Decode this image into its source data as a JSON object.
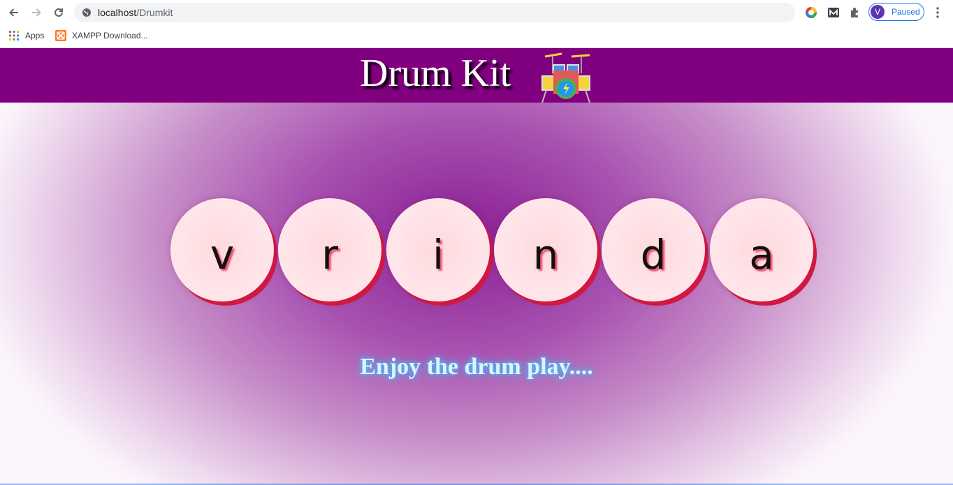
{
  "browser": {
    "url_host": "localhost",
    "url_path": "/Drumkit",
    "profile": {
      "initial": "V",
      "status": "Paused"
    },
    "bookmarks": [
      {
        "label": "Apps",
        "icon": "apps-grid-icon"
      },
      {
        "label": "XAMPP Download...",
        "icon": "xampp-icon"
      }
    ]
  },
  "page": {
    "title": "Drum Kit",
    "logo_icon": "drum-set-icon",
    "drums": [
      {
        "key": "v"
      },
      {
        "key": "r"
      },
      {
        "key": "i"
      },
      {
        "key": "n"
      },
      {
        "key": "d"
      },
      {
        "key": "a"
      }
    ],
    "footer": "Enjoy the drum play....",
    "colors": {
      "header_bg": "#800080",
      "drum_face": "#ffe4e8",
      "drum_shadow": "#d01840",
      "footer_glow": "#3fc0ff"
    }
  }
}
